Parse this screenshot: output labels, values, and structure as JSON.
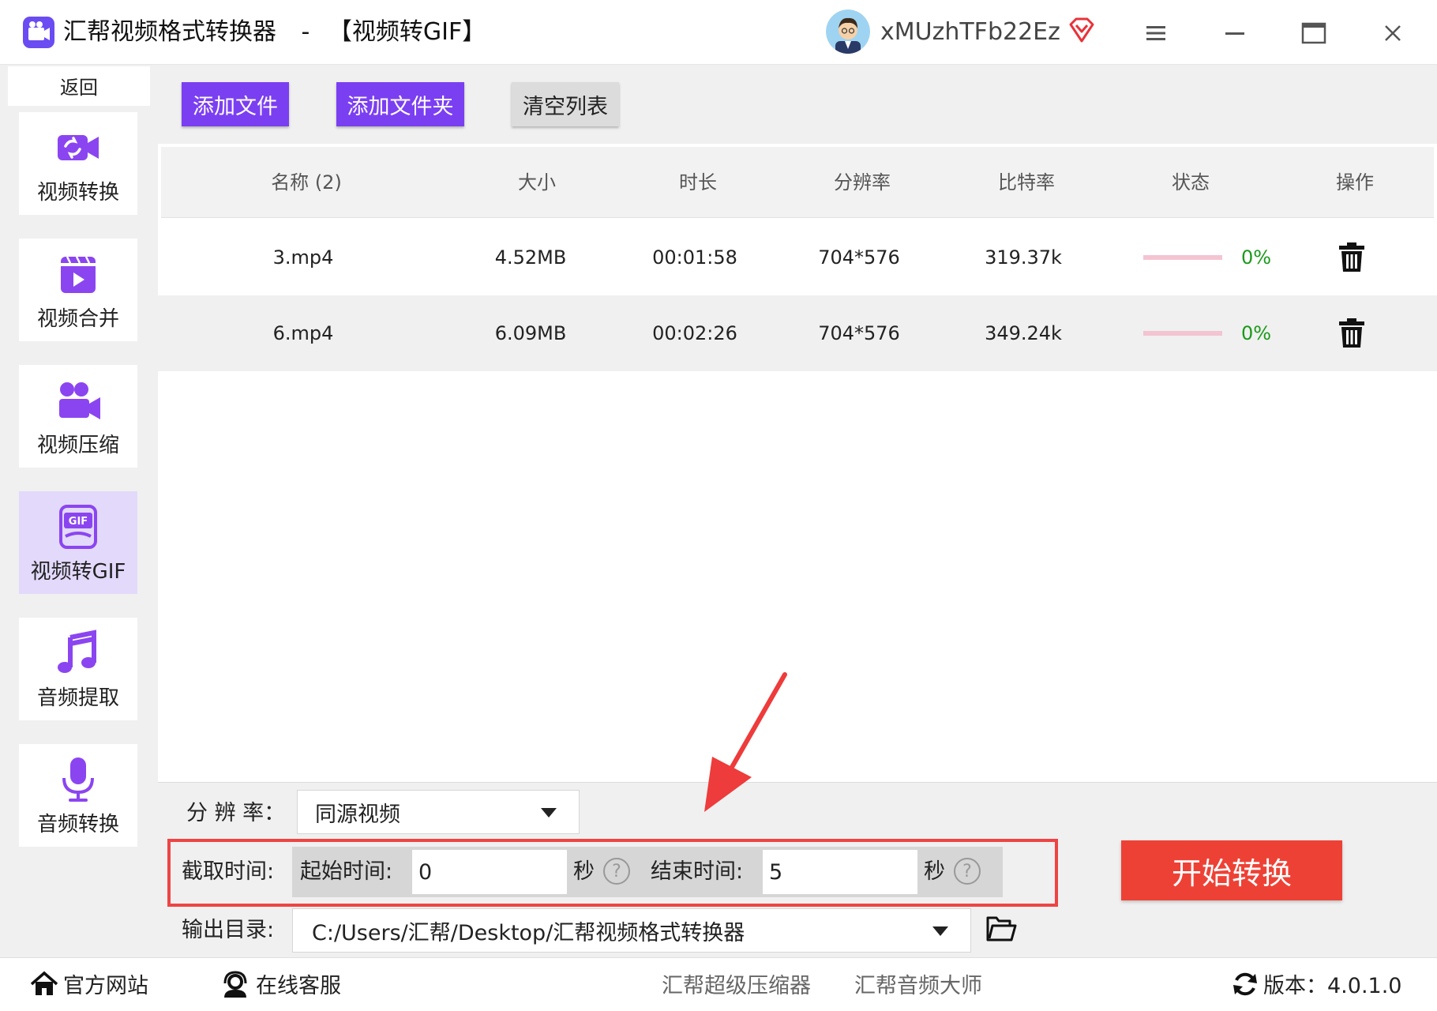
{
  "window": {
    "app_name": "汇帮视频格式转换器",
    "separator": "-",
    "mode": "【视频转GIF】",
    "username": "xMUzhTFb22Ez"
  },
  "sidebar": {
    "back": "返回",
    "items": [
      {
        "label": "视频转换",
        "icon": "video-convert-icon"
      },
      {
        "label": "视频合并",
        "icon": "video-merge-icon"
      },
      {
        "label": "视频压缩",
        "icon": "video-compress-icon"
      },
      {
        "label": "视频转GIF",
        "icon": "gif-icon",
        "active": true
      },
      {
        "label": "音频提取",
        "icon": "music-note-icon"
      },
      {
        "label": "音频转换",
        "icon": "microphone-icon"
      }
    ]
  },
  "toolbar": {
    "add_file": "添加文件",
    "add_folder": "添加文件夹",
    "clear_list": "清空列表"
  },
  "table": {
    "headers": [
      "名称 (2)",
      "大小",
      "时长",
      "分辨率",
      "比特率",
      "状态",
      "操作"
    ],
    "rows": [
      {
        "name": "3.mp4",
        "size": "4.52MB",
        "duration": "00:01:58",
        "resolution": "704*576",
        "bitrate": "319.37k",
        "progress_text": "0%",
        "progress": 0
      },
      {
        "name": "6.mp4",
        "size": "6.09MB",
        "duration": "00:02:26",
        "resolution": "704*576",
        "bitrate": "349.24k",
        "progress_text": "0%",
        "progress": 0
      }
    ]
  },
  "settings": {
    "resolution_label": "分 辨 率：",
    "resolution_value": "同源视频",
    "clip_label": "截取时间:",
    "start_label": "起始时间:",
    "start_value": "0",
    "start_unit": "秒",
    "end_label": "结束时间:",
    "end_value": "5",
    "end_unit": "秒",
    "help_symbol": "?",
    "output_label": "输出目录:",
    "output_path": "C:/Users/汇帮/Desktop/汇帮视频格式转换器",
    "start_button": "开始转换"
  },
  "footer": {
    "website": "官方网站",
    "support": "在线客服",
    "link1": "汇帮超级压缩器",
    "link2": "汇帮音频大师",
    "version": "版本：4.0.1.0"
  },
  "colors": {
    "accent_purple": "#7b3ff2",
    "start_red": "#ee4135",
    "highlight_red": "#ee4444",
    "progress_pink": "#f3c4d2",
    "percent_green": "#1a9a1a"
  }
}
